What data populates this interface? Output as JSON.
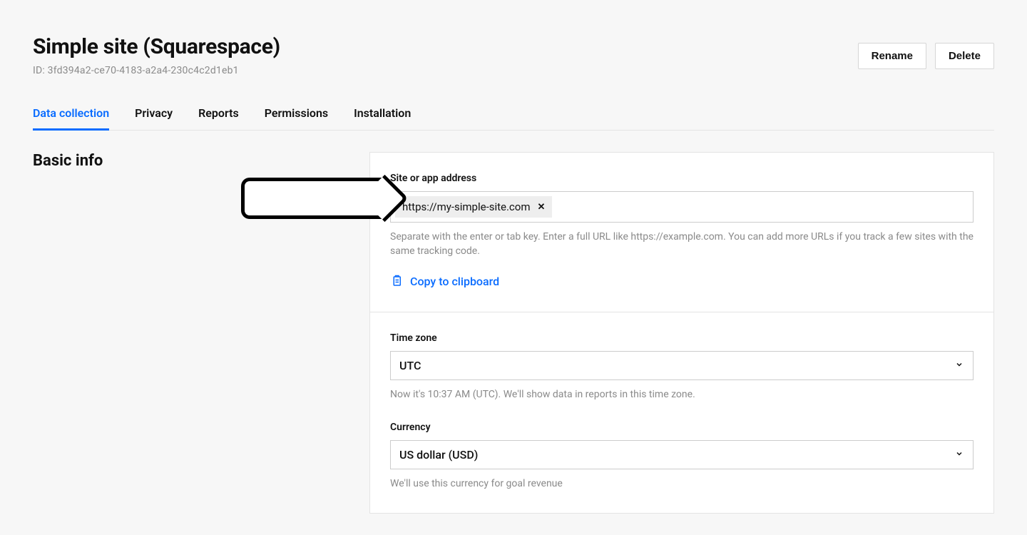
{
  "header": {
    "title": "Simple site (Squarespace)",
    "id_label": "ID: 3fd394a2-ce70-4183-a2a4-230c4c2d1eb1",
    "rename": "Rename",
    "delete": "Delete"
  },
  "tabs": [
    {
      "label": "Data collection",
      "active": true
    },
    {
      "label": "Privacy",
      "active": false
    },
    {
      "label": "Reports",
      "active": false
    },
    {
      "label": "Permissions",
      "active": false
    },
    {
      "label": "Installation",
      "active": false
    }
  ],
  "section": {
    "title": "Basic info"
  },
  "basic": {
    "site_label": "Site or app address",
    "site_url": "https://my-simple-site.com",
    "site_help": "Separate with the enter or tab key. Enter a full URL like https://example.com. You can add more URLs if you track a few sites with the same tracking code.",
    "copy_label": "Copy to clipboard",
    "chip_close": "✕"
  },
  "tz": {
    "label": "Time zone",
    "value": "UTC",
    "help": "Now it's 10:37 AM (UTC). We'll show data in reports in this time zone."
  },
  "cur": {
    "label": "Currency",
    "value": "US dollar (USD)",
    "help": "We'll use this currency for goal revenue"
  }
}
